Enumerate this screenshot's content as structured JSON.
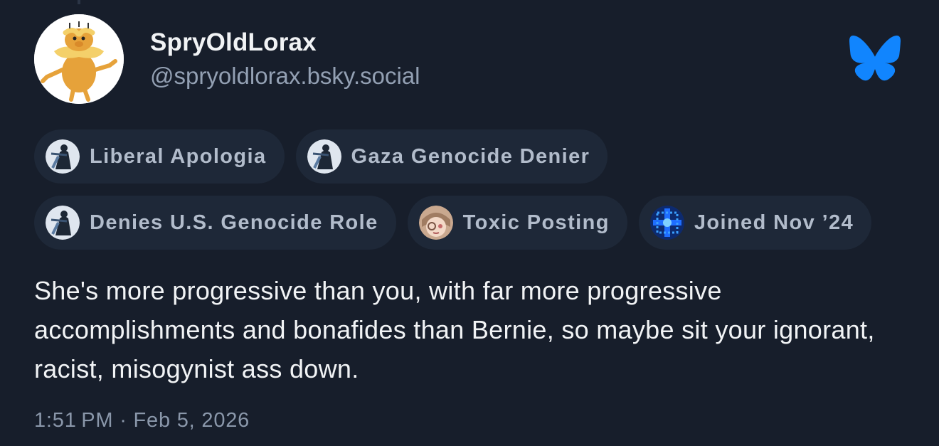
{
  "author": {
    "display_name": "SpryOldLorax",
    "handle": "@spryoldlorax.bsky.social",
    "avatar_icon": "lorax-avatar"
  },
  "app_icon": "bluesky-butterfly-icon",
  "colors": {
    "background": "#171e2b",
    "pill_background": "#1e2838",
    "bluesky_blue": "#1185fe",
    "label_text": "#b2bccb",
    "secondary_text": "#93a0b3"
  },
  "labels": [
    {
      "text": "Liberal Apologia",
      "icon": "moderator-shield-icon"
    },
    {
      "text": "Gaza Genocide Denier",
      "icon": "moderator-shield-icon"
    },
    {
      "text": "Denies U.S. Genocide Role",
      "icon": "moderator-shield-icon"
    },
    {
      "text": "Toxic Posting",
      "icon": "anime-avatar-icon"
    },
    {
      "text": "Joined Nov ’24",
      "icon": "blue-pixel-icon"
    }
  ],
  "post": {
    "text": "She's more progressive than you, with far more progressive accomplishments and bonafides than Bernie, so maybe sit your ignorant, racist, misogynist ass down.",
    "timestamp": "1:51 PM · Feb 5, 2026"
  }
}
